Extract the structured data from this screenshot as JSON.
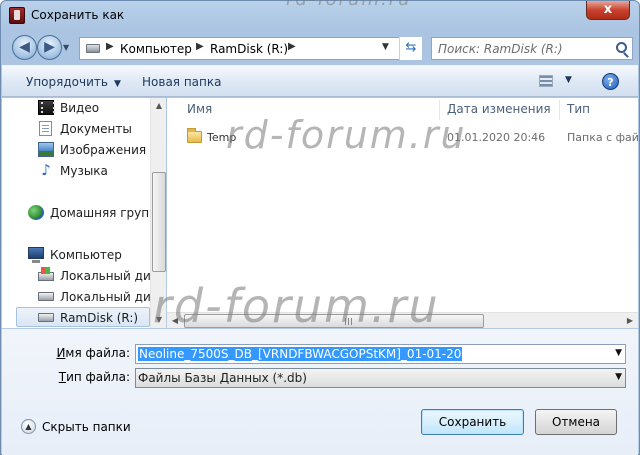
{
  "window": {
    "title": "Сохранить как",
    "close_label": "x"
  },
  "address_bar": {
    "segments": [
      "Компьютер",
      "RamDisk (R:)"
    ],
    "search_placeholder": "Поиск: RamDisk (R:)"
  },
  "toolbar": {
    "organize_label": "Упорядочить",
    "new_folder_label": "Новая папка"
  },
  "nav_pane": {
    "items": [
      {
        "label": "Видео",
        "icon": "video-library-icon"
      },
      {
        "label": "Документы",
        "icon": "documents-library-icon"
      },
      {
        "label": "Изображения",
        "icon": "pictures-library-icon"
      },
      {
        "label": "Музыка",
        "icon": "music-library-icon"
      },
      {
        "label": "Домашняя группа",
        "icon": "homegroup-icon"
      },
      {
        "label": "Компьютер",
        "icon": "computer-icon"
      },
      {
        "label": "Локальный диск",
        "icon": "system-drive-icon"
      },
      {
        "label": "Локальный диск",
        "icon": "local-drive-icon"
      },
      {
        "label": "RamDisk (R:)",
        "icon": "ramdisk-drive-icon",
        "selected": true
      }
    ]
  },
  "file_list": {
    "columns": [
      "Имя",
      "Дата изменения",
      "Тип"
    ],
    "rows": [
      {
        "name": "Temp",
        "modified": "01.01.2020 20:46",
        "type": "Папка с файл"
      }
    ]
  },
  "form": {
    "filename_label_u": "И",
    "filename_label_rest": "мя файла:",
    "filename_value": "Neoline_7500S_DB_[VRNDFBWACGOPStKM]_01-01-20",
    "filetype_label_u": "Т",
    "filetype_label_rest": "ип файла:",
    "filetype_value": "Файлы Базы Данных (*.db)"
  },
  "footer": {
    "hide_folders_label": "Скрыть папки",
    "save_label": "Сохранить",
    "cancel_label": "Отмена"
  },
  "watermarks": [
    "rd-forum.ru",
    "rd-forum.ru",
    "rd-forum.ru"
  ]
}
